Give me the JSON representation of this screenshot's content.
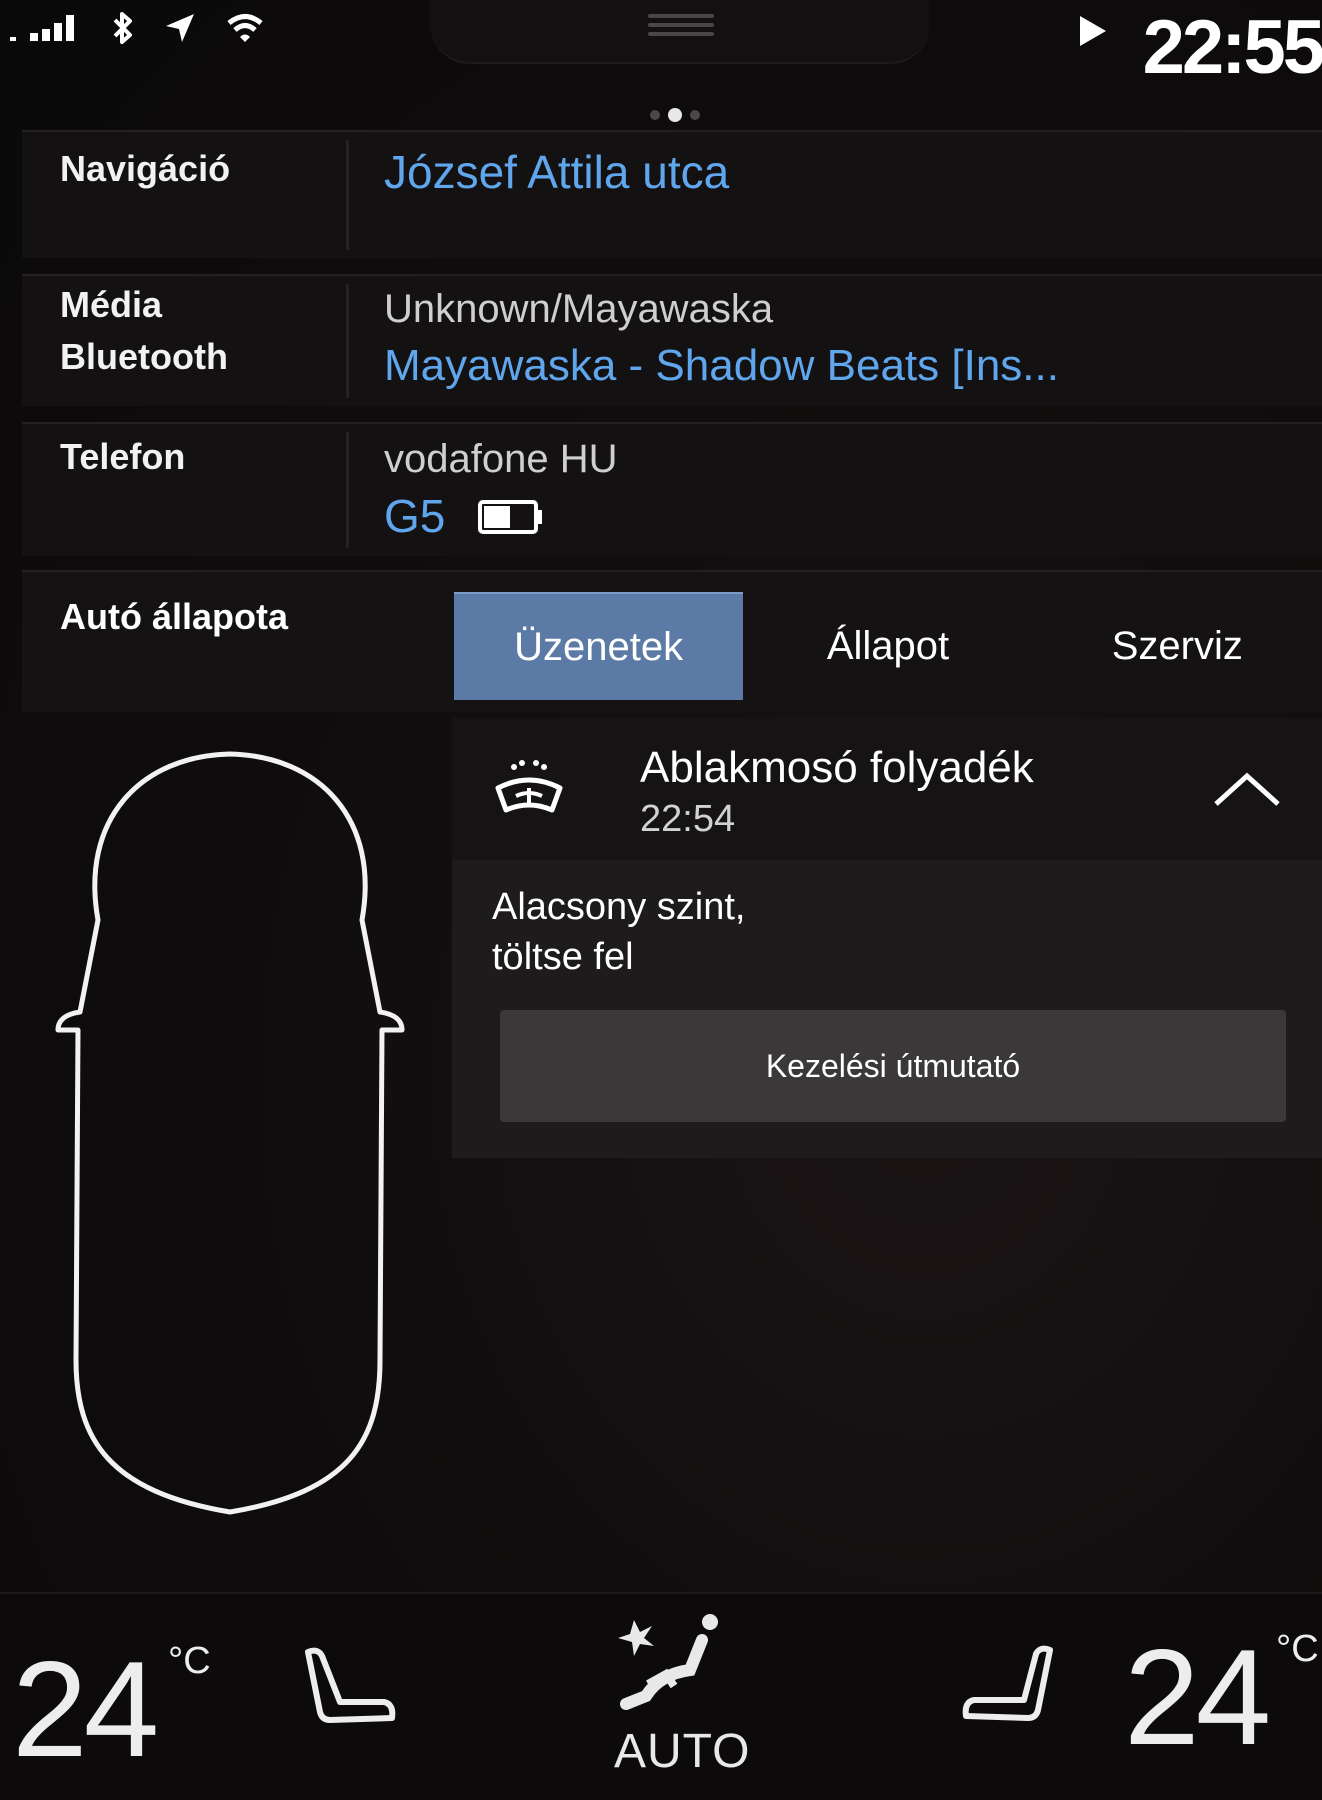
{
  "status_bar": {
    "clock": "22:55",
    "icons": [
      "signal-icon",
      "bluetooth-icon",
      "location-icon",
      "wifi-icon",
      "play-icon"
    ]
  },
  "navigation": {
    "label": "Navigáció",
    "destination": "József Attila utca"
  },
  "media": {
    "label_line1": "Média",
    "label_line2": "Bluetooth",
    "artist_album": "Unknown/Mayawaska",
    "track": "Mayawaska - Shadow Beats [Ins..."
  },
  "phone": {
    "label": "Telefon",
    "carrier": "vodafone HU",
    "device": "G5",
    "battery_level": 0.55
  },
  "car_status": {
    "title": "Autó állapota",
    "tabs": [
      {
        "label": "Üzenetek",
        "active": true
      },
      {
        "label": "Állapot",
        "active": false
      },
      {
        "label": "Szerviz",
        "active": false
      }
    ],
    "message": {
      "title": "Ablakmosó folyadék",
      "time": "22:54",
      "body_line1": "Alacsony szint,",
      "body_line2": "töltse fel",
      "button": "Kezelési útmutató"
    }
  },
  "climate": {
    "left_temp": "24",
    "right_temp": "24",
    "unit": "°C",
    "mode": "AUTO"
  },
  "colors": {
    "accent_blue": "#5fa6ec",
    "active_tab": "#5b7aa6"
  }
}
